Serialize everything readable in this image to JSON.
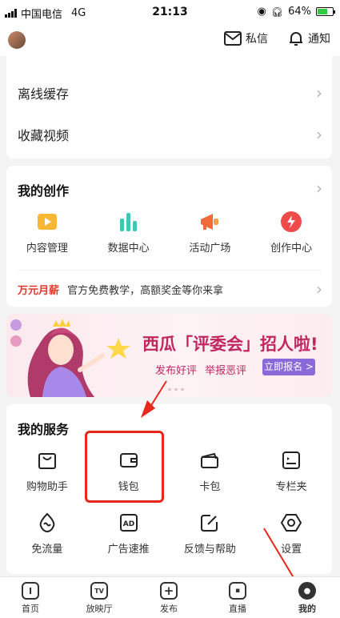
{
  "status_bar": {
    "carrier": "中国电信",
    "network": "4G",
    "time": "21:13",
    "battery": "64%",
    "battery_level": 0.64
  },
  "header": {
    "messages_label": "私信",
    "notifications_label": "通知"
  },
  "top_list": {
    "items": [
      {
        "label": "离线缓存"
      },
      {
        "label": "收藏视频"
      }
    ]
  },
  "creation": {
    "title": "我的创作",
    "items": [
      {
        "label": "内容管理",
        "icon": "content-management-icon"
      },
      {
        "label": "数据中心",
        "icon": "data-center-icon"
      },
      {
        "label": "活动广场",
        "icon": "event-square-icon"
      },
      {
        "label": "创作中心",
        "icon": "creator-center-icon"
      }
    ],
    "promo_highlight": "万元月薪",
    "promo_text": "官方免费教学，高额奖金等你来拿"
  },
  "banner": {
    "headline": "西瓜「评委会」招人啦!",
    "sub1": "发布好评",
    "sub2": "举报恶评",
    "cta": "立即报名 >"
  },
  "services": {
    "title": "我的服务",
    "items": [
      {
        "label": "购物助手",
        "icon": "shopping-bag-icon"
      },
      {
        "label": "钱包",
        "icon": "wallet-icon"
      },
      {
        "label": "卡包",
        "icon": "card-holder-icon"
      },
      {
        "label": "专栏夹",
        "icon": "column-folder-icon"
      },
      {
        "label": "免流量",
        "icon": "free-data-icon"
      },
      {
        "label": "广告速推",
        "icon": "ad-boost-icon"
      },
      {
        "label": "反馈与帮助",
        "icon": "feedback-icon"
      },
      {
        "label": "设置",
        "icon": "settings-icon"
      }
    ]
  },
  "tabbar": {
    "items": [
      {
        "label": "首页"
      },
      {
        "label": "放映厅"
      },
      {
        "label": "发布"
      },
      {
        "label": "直播"
      },
      {
        "label": "我的"
      }
    ]
  },
  "colors": {
    "accent_red": "#e8261c",
    "promo_red": "#e0392b",
    "banner_purple": "#c0275f"
  }
}
